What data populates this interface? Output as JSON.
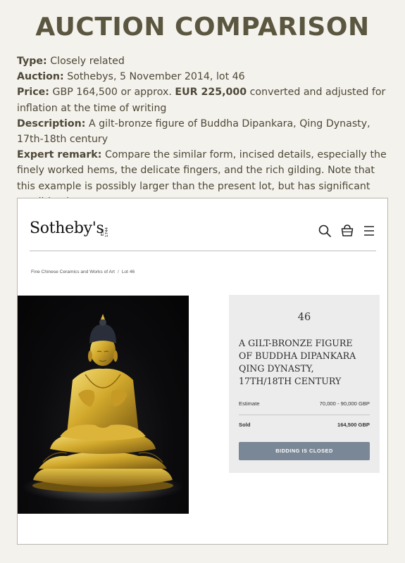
{
  "heading": "AUCTION COMPARISON",
  "details": {
    "type_label": "Type:",
    "type_value": "Closely related",
    "auction_label": "Auction:",
    "auction_value": "Sothebys, 5 November 2014, lot 46",
    "price_label": "Price:",
    "price_prefix": "GBP 164,500 or approx.",
    "price_eur": "EUR 225,000",
    "price_suffix": "converted and adjusted for inflation at the time of writing",
    "description_label": "Description:",
    "description_value": "A gilt-bronze figure of Buddha Dipankara, Qing Dynasty, 17th-18th century",
    "remark_label": "Expert remark:",
    "remark_value": "Compare the similar form, incised details, especially the finely worked hems, the delicate fingers, and the rich gilding. Note that this example is possibly larger than the present lot, but has significant condition issues."
  },
  "screenshot": {
    "logo": "Sotheby's",
    "logo_est": "EST 1744",
    "icons": [
      "search-icon",
      "bag-icon",
      "menu-icon"
    ],
    "breadcrumb": [
      "Fine Chinese Ceramics and Works of Art",
      "Lot 46"
    ],
    "breadcrumb_sep": "/",
    "lot": {
      "number": "46",
      "title_lines": [
        "A GILT-BRONZE FIGURE",
        "OF BUDDHA DIPANKARA",
        "QING DYNASTY,",
        "17TH/18TH CENTURY"
      ],
      "estimate_label": "Estimate",
      "estimate_value": "70,000 - 90,000 GBP",
      "sold_label": "Sold",
      "sold_value": "164,500 GBP",
      "button_label": "BIDDING IS CLOSED"
    },
    "colors": {
      "page_bg": "#f4f2ec",
      "heading": "#5a5640",
      "button": "#7a8796",
      "card_bg": "#ececec",
      "gold": "#c9a227"
    }
  }
}
